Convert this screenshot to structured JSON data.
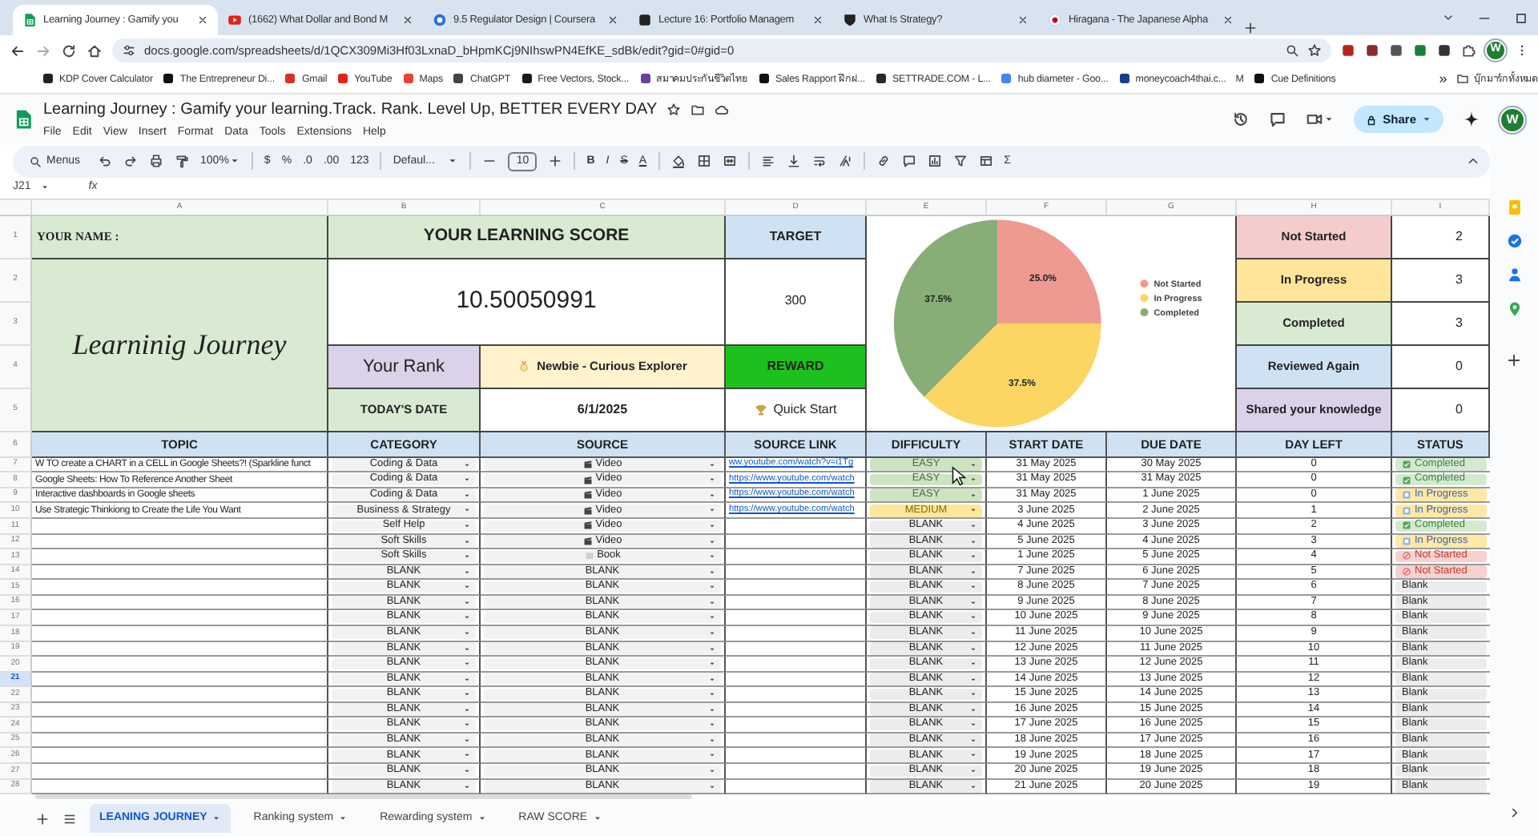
{
  "browser": {
    "tabs": [
      {
        "title": "Learning Journey : Gamify you",
        "selected": true
      },
      {
        "title": "(1662) What Dollar and Bond M",
        "selected": false
      },
      {
        "title": "9.5 Regulator Design | Coursera",
        "selected": false
      },
      {
        "title": "Lecture 16: Portfolio Managem",
        "selected": false
      },
      {
        "title": "What Is Strategy?",
        "selected": false
      },
      {
        "title": "Hiragana - The Japanese Alpha",
        "selected": false
      }
    ],
    "url": "docs.google.com/spreadsheets/d/1QCX309Mi3Hf03LxnaD_bHpmKCj9NIhswPN4EfKE_sdBk/edit?gid=0#gid=0",
    "avatar": "W",
    "bookmarks": [
      "KDP Cover Calculator",
      "The Entrepreneur Di...",
      "Gmail",
      "YouTube",
      "Maps",
      "ChatGPT",
      "Free Vectors, Stock...",
      "สมาคมประกันชีวิตไทย",
      "Sales Rapport ฝึกฝ...",
      "SETTRADE.COM - L...",
      "hub diameter - Goo...",
      "moneycoach4thai.c...",
      "M",
      "Cue Definitions"
    ],
    "more_bookmarks": "»",
    "all_bookmarks": "บุ๊กมาร์กทั้งหมด"
  },
  "sheet": {
    "title": "Learning Journey : Gamify your learning.Track. Rank. Level Up, BETTER EVERY DAY",
    "menu": [
      "File",
      "Edit",
      "View",
      "Insert",
      "Format",
      "Data",
      "Tools",
      "Extensions",
      "Help"
    ],
    "share": "Share",
    "avatar": "W",
    "toolbar": {
      "search": "Menus",
      "zoom": "100%",
      "currency": "$",
      "percent": "%",
      "decrease_decimals": ".0",
      "increase_decimals": ".00",
      "number_format": "123",
      "font": "Defaul...",
      "font_size": "10",
      "bold": "B",
      "italic": "I",
      "strikethrough": "S",
      "text_color": "A",
      "functions": "Σ"
    },
    "name_box": "J21",
    "fx": "fx"
  },
  "column_letters": [
    "A",
    "B",
    "C",
    "D",
    "E",
    "F",
    "G",
    "H",
    "I"
  ],
  "row_numbers": [
    {
      "label": "1",
      "selected": false
    },
    {
      "label": "2",
      "selected": false
    },
    {
      "label": "3",
      "selected": false
    },
    {
      "label": "4",
      "selected": false
    },
    {
      "label": "5",
      "selected": false
    },
    {
      "label": "6",
      "selected": false
    },
    {
      "label": "7",
      "selected": false
    },
    {
      "label": "8",
      "selected": false
    },
    {
      "label": "9",
      "selected": false
    },
    {
      "label": "10",
      "selected": false
    },
    {
      "label": "11",
      "selected": false
    },
    {
      "label": "12",
      "selected": false
    },
    {
      "label": "13",
      "selected": false
    },
    {
      "label": "14",
      "selected": false
    },
    {
      "label": "15",
      "selected": false
    },
    {
      "label": "16",
      "selected": false
    },
    {
      "label": "17",
      "selected": false
    },
    {
      "label": "18",
      "selected": false
    },
    {
      "label": "19",
      "selected": false
    },
    {
      "label": "20",
      "selected": false
    },
    {
      "label": "21",
      "selected": true
    },
    {
      "label": "22",
      "selected": false
    },
    {
      "label": "23",
      "selected": false
    },
    {
      "label": "24",
      "selected": false
    },
    {
      "label": "25",
      "selected": false
    },
    {
      "label": "26",
      "selected": false
    },
    {
      "label": "27",
      "selected": false
    },
    {
      "label": "28",
      "selected": false
    }
  ],
  "summary": {
    "name_label": "YOUR NAME :",
    "journey_title": "Learninig Journey",
    "score_label": "YOUR LEARNING SCORE",
    "score": "10.50050991",
    "rank_label": "Your Rank",
    "rank": "Newbie - Curious Explorer",
    "date_label": "TODAY'S DATE",
    "date": "6/1/2025",
    "target_label": "TARGET",
    "target": "300",
    "reward_label": "REWARD",
    "reward": "Quick Start",
    "status_counts": [
      {
        "label": "Not Started",
        "count": "2",
        "color": "#f4cccc"
      },
      {
        "label": "In Progress",
        "count": "3",
        "color": "#ffe599"
      },
      {
        "label": "Completed",
        "count": "3",
        "color": "#d9ead3"
      },
      {
        "label": "Reviewed Again",
        "count": "0",
        "color": "#cfe2f3"
      },
      {
        "label": "Shared your knowledge",
        "count": "0",
        "color": "#d9d2e9"
      }
    ]
  },
  "chart_data": {
    "type": "pie",
    "categories": [
      "Not Started",
      "In Progress",
      "Completed"
    ],
    "values": [
      25,
      37.5,
      37.5
    ],
    "colors": [
      "#ee9a90",
      "#fcd663",
      "#88ad76"
    ],
    "value_labels": [
      "25.0%",
      "37.5%",
      "37.5%"
    ],
    "legend": "right"
  },
  "table": {
    "columns": [
      "TOPIC",
      "CATEGORY",
      "SOURCE",
      "SOURCE LINK",
      "DIFFICULTY",
      "START DATE",
      "DUE DATE",
      "DAY LEFT",
      "STATUS"
    ],
    "rows": [
      {
        "topic": "W TO create a CHART in a CELL in Google Sheets?! (Sparkline funct",
        "category": "Coding & Data",
        "source": {
          "label": "Video",
          "kind": "video"
        },
        "link": "ww.youtube.com/watch?v=i1Tg",
        "difficulty": {
          "label": "EASY",
          "kind": "easy"
        },
        "start": "31 May 2025",
        "due": "30 May 2025",
        "day_left": "0",
        "status": {
          "label": "Completed",
          "kind": "completed"
        }
      },
      {
        "topic": "Google Sheets: How To Reference Another Sheet",
        "category": "Coding & Data",
        "source": {
          "label": "Video",
          "kind": "video"
        },
        "link": "https://www.youtube.com/watch",
        "difficulty": {
          "label": "EASY",
          "kind": "easy"
        },
        "start": "31 May 2025",
        "due": "31 May 2025",
        "day_left": "0",
        "status": {
          "label": "Completed",
          "kind": "completed"
        }
      },
      {
        "topic": "Interactive dashboards in Google sheets",
        "category": "Coding & Data",
        "source": {
          "label": "Video",
          "kind": "video"
        },
        "link": "https://www.youtube.com/watch",
        "difficulty": {
          "label": "EASY",
          "kind": "easy"
        },
        "start": "31 May 2025",
        "due": "1 June 2025",
        "day_left": "0",
        "status": {
          "label": "In Progress",
          "kind": "in_progress"
        }
      },
      {
        "topic": "Use Strategic Thinkiong to Create the Life You Want",
        "category": "Business & Strategy",
        "source": {
          "label": "Video",
          "kind": "video"
        },
        "link": "https://www.youtube.com/watch",
        "difficulty": {
          "label": "MEDIUM",
          "kind": "medium"
        },
        "start": "3 June 2025",
        "due": "2 June 2025",
        "day_left": "1",
        "status": {
          "label": "In Progress",
          "kind": "in_progress"
        }
      },
      {
        "category": "Self  Help",
        "source": {
          "label": "Video",
          "kind": "video"
        },
        "difficulty": {
          "label": "BLANK",
          "kind": "blank"
        },
        "start": "4 June 2025",
        "due": "3 June 2025",
        "day_left": "2",
        "status": {
          "label": "Completed",
          "kind": "completed"
        }
      },
      {
        "category": "Soft Skills",
        "source": {
          "label": "Video",
          "kind": "video"
        },
        "difficulty": {
          "label": "BLANK",
          "kind": "blank"
        },
        "start": "5 June 2025",
        "due": "4 June 2025",
        "day_left": "3",
        "status": {
          "label": "In Progress",
          "kind": "in_progress"
        }
      },
      {
        "category": "Soft Skills",
        "source": {
          "label": "Book",
          "kind": "book"
        },
        "difficulty": {
          "label": "BLANK",
          "kind": "blank"
        },
        "start": "1 June 2025",
        "due": "5 June 2025",
        "day_left": "4",
        "status": {
          "label": "Not Started",
          "kind": "not_started"
        }
      },
      {
        "category": "BLANK",
        "source": {
          "label": "BLANK",
          "kind": "blank"
        },
        "difficulty": {
          "label": "BLANK",
          "kind": "blank"
        },
        "start": "7 June 2025",
        "due": "6 June 2025",
        "day_left": "5",
        "status": {
          "label": "Not Started",
          "kind": "not_started"
        }
      },
      {
        "category": "BLANK",
        "source": {
          "label": "BLANK",
          "kind": "blank"
        },
        "difficulty": {
          "label": "BLANK",
          "kind": "blank"
        },
        "start": "8 June 2025",
        "due": "7 June 2025",
        "day_left": "6",
        "status": {
          "label": "Blank",
          "kind": "blank"
        }
      },
      {
        "category": "BLANK",
        "source": {
          "label": "BLANK",
          "kind": "blank"
        },
        "difficulty": {
          "label": "BLANK",
          "kind": "blank"
        },
        "start": "9 June 2025",
        "due": "8 June 2025",
        "day_left": "7",
        "status": {
          "label": "Blank",
          "kind": "blank"
        }
      },
      {
        "category": "BLANK",
        "source": {
          "label": "BLANK",
          "kind": "blank"
        },
        "difficulty": {
          "label": "BLANK",
          "kind": "blank"
        },
        "start": "10 June 2025",
        "due": "9 June 2025",
        "day_left": "8",
        "status": {
          "label": "Blank",
          "kind": "blank"
        }
      },
      {
        "category": "BLANK",
        "source": {
          "label": "BLANK",
          "kind": "blank"
        },
        "difficulty": {
          "label": "BLANK",
          "kind": "blank"
        },
        "start": "11 June 2025",
        "due": "10 June 2025",
        "day_left": "9",
        "status": {
          "label": "Blank",
          "kind": "blank"
        }
      },
      {
        "category": "BLANK",
        "source": {
          "label": "BLANK",
          "kind": "blank"
        },
        "difficulty": {
          "label": "BLANK",
          "kind": "blank"
        },
        "start": "12 June 2025",
        "due": "11 June 2025",
        "day_left": "10",
        "status": {
          "label": "Blank",
          "kind": "blank"
        }
      },
      {
        "category": "BLANK",
        "source": {
          "label": "BLANK",
          "kind": "blank"
        },
        "difficulty": {
          "label": "BLANK",
          "kind": "blank"
        },
        "start": "13 June 2025",
        "due": "12 June 2025",
        "day_left": "11",
        "status": {
          "label": "Blank",
          "kind": "blank"
        }
      },
      {
        "category": "BLANK",
        "source": {
          "label": "BLANK",
          "kind": "blank"
        },
        "difficulty": {
          "label": "BLANK",
          "kind": "blank"
        },
        "start": "14 June 2025",
        "due": "13 June 2025",
        "day_left": "12",
        "status": {
          "label": "Blank",
          "kind": "blank"
        }
      },
      {
        "category": "BLANK",
        "source": {
          "label": "BLANK",
          "kind": "blank"
        },
        "difficulty": {
          "label": "BLANK",
          "kind": "blank"
        },
        "start": "15 June 2025",
        "due": "14 June 2025",
        "day_left": "13",
        "status": {
          "label": "Blank",
          "kind": "blank"
        }
      },
      {
        "category": "BLANK",
        "source": {
          "label": "BLANK",
          "kind": "blank"
        },
        "difficulty": {
          "label": "BLANK",
          "kind": "blank"
        },
        "start": "16 June 2025",
        "due": "15 June 2025",
        "day_left": "14",
        "status": {
          "label": "Blank",
          "kind": "blank"
        }
      },
      {
        "category": "BLANK",
        "source": {
          "label": "BLANK",
          "kind": "blank"
        },
        "difficulty": {
          "label": "BLANK",
          "kind": "blank"
        },
        "start": "17 June 2025",
        "due": "16 June 2025",
        "day_left": "15",
        "status": {
          "label": "Blank",
          "kind": "blank"
        }
      },
      {
        "category": "BLANK",
        "source": {
          "label": "BLANK",
          "kind": "blank"
        },
        "difficulty": {
          "label": "BLANK",
          "kind": "blank"
        },
        "start": "18 June 2025",
        "due": "17 June 2025",
        "day_left": "16",
        "status": {
          "label": "Blank",
          "kind": "blank"
        }
      },
      {
        "category": "BLANK",
        "source": {
          "label": "BLANK",
          "kind": "blank"
        },
        "difficulty": {
          "label": "BLANK",
          "kind": "blank"
        },
        "start": "19 June 2025",
        "due": "18 June 2025",
        "day_left": "17",
        "status": {
          "label": "Blank",
          "kind": "blank"
        }
      },
      {
        "category": "BLANK",
        "source": {
          "label": "BLANK",
          "kind": "blank"
        },
        "difficulty": {
          "label": "BLANK",
          "kind": "blank"
        },
        "start": "20 June 2025",
        "due": "19 June 2025",
        "day_left": "18",
        "status": {
          "label": "Blank",
          "kind": "blank"
        }
      },
      {
        "category": "BLANK",
        "source": {
          "label": "BLANK",
          "kind": "blank"
        },
        "difficulty": {
          "label": "BLANK",
          "kind": "blank"
        },
        "start": "21 June 2025",
        "due": "20 June 2025",
        "day_left": "19",
        "status": {
          "label": "Blank",
          "kind": "blank"
        }
      }
    ]
  },
  "sheet_tabs": [
    {
      "label": "LEANING JOURNEY",
      "selected": true
    },
    {
      "label": "Ranking system",
      "selected": false
    },
    {
      "label": "Rewarding system",
      "selected": false
    },
    {
      "label": "RAW SCORE",
      "selected": false
    }
  ]
}
